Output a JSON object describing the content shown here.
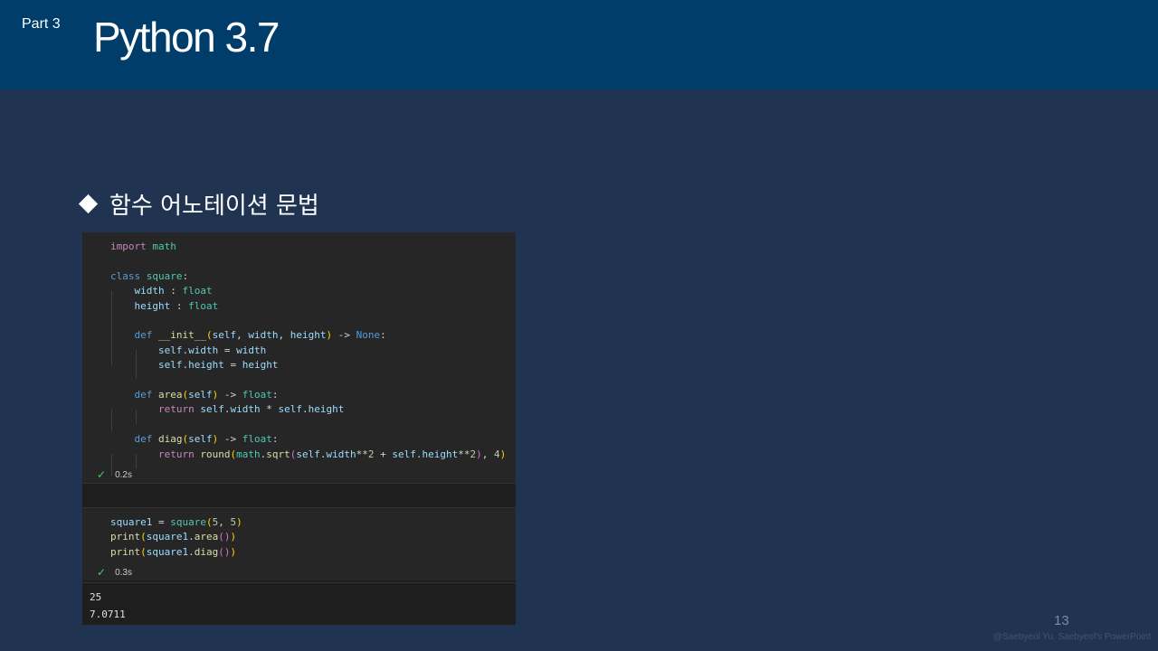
{
  "header": {
    "part": "Part 3",
    "title": "Python 3.7"
  },
  "subtitle": "함수 어노테이션 문법",
  "cell1": {
    "status_time": "0.2s"
  },
  "cell2": {
    "status_time": "0.3s"
  },
  "output": {
    "line1": "25",
    "line2": "7.0711"
  },
  "footer": {
    "page_number": "13",
    "credit": "@Saebyeol Yu. Saebyeol's PowerPoint"
  },
  "colors": {
    "header_bg": "#003d6b",
    "slide_bg": "#203452",
    "success": "#4ec961"
  }
}
